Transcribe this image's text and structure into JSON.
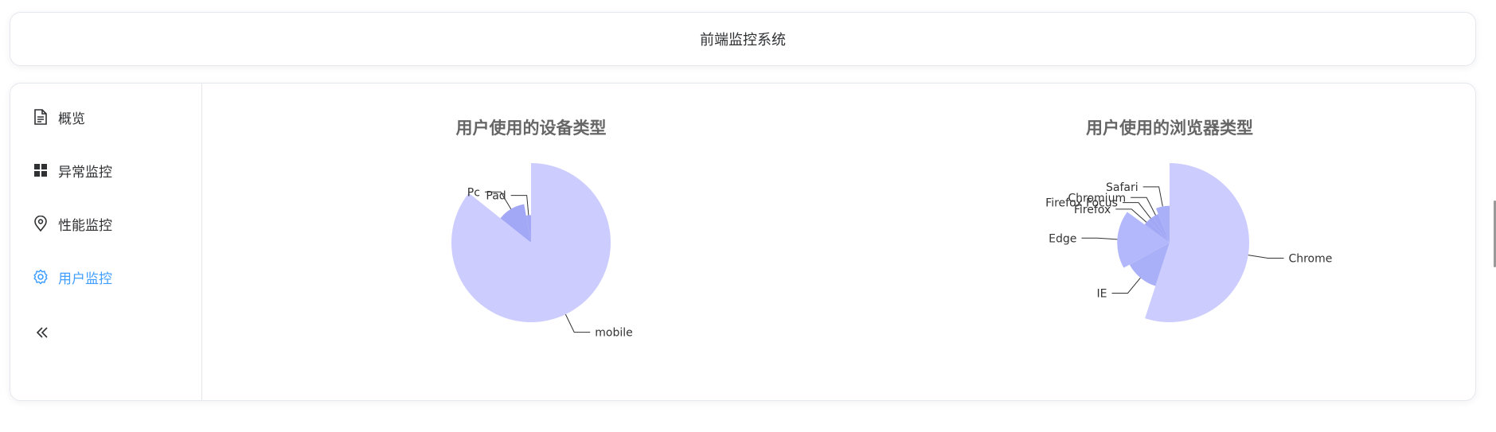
{
  "header": {
    "title": "前端监控系统"
  },
  "sidebar": {
    "items": [
      {
        "label": "概览",
        "icon": "document-icon"
      },
      {
        "label": "异常监控",
        "icon": "grid-icon"
      },
      {
        "label": "性能监控",
        "icon": "location-icon"
      },
      {
        "label": "用户监控",
        "icon": "gear-icon"
      }
    ],
    "active_index": 3,
    "active_color": "#409eff",
    "collapse_icon": "double-chevron-left-icon"
  },
  "chart_data": [
    {
      "type": "pie",
      "variant": "rose",
      "title": "用户使用的设备类型",
      "categories": [
        "mobile",
        "Pc",
        "Pad"
      ],
      "values": [
        60,
        8,
        2
      ],
      "colors": [
        "#ccccff",
        "#a3a8f6",
        "#a3a8f6"
      ]
    },
    {
      "type": "pie",
      "variant": "rose",
      "title": "用户使用的浏览器类型",
      "categories": [
        "Chrome",
        "IE",
        "Edge",
        "Firefox",
        "Firefox Focus",
        "Chromium",
        "Safari"
      ],
      "values": [
        55,
        12,
        18,
        3,
        3,
        3,
        6
      ],
      "colors": [
        "#ccccff",
        "#aab0f8",
        "#b2b8fb",
        "#a3a8f6",
        "#a3a8f6",
        "#a3a8f6",
        "#aab0f8"
      ]
    }
  ]
}
